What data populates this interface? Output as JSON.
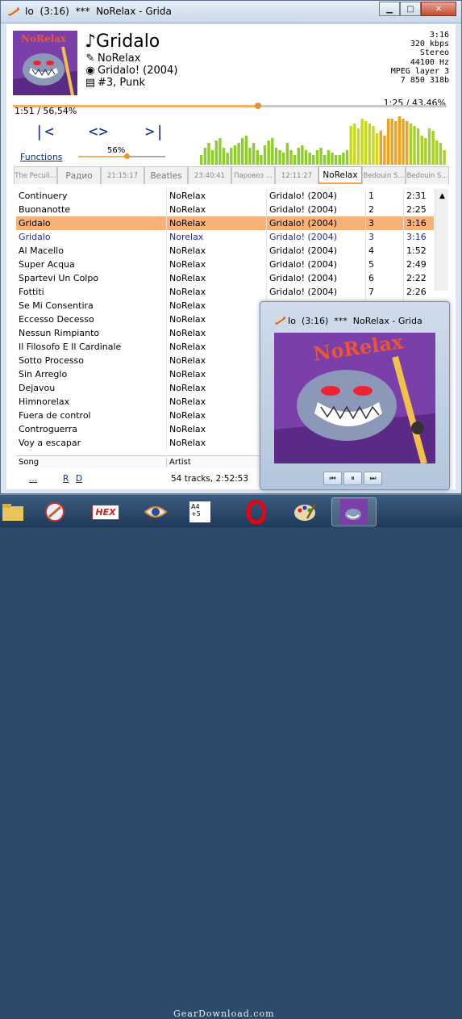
{
  "window": {
    "title": "Io  (3:16)  ***  NoRelax - Grida",
    "minimize": "▁",
    "maximize": "□",
    "close": "✕"
  },
  "now_playing": {
    "cover_brand": "NoRelax",
    "title": "Gridalo",
    "artist": "NoRelax",
    "album": "Gridalo! (2004)",
    "track": "#3, Punk",
    "tech": [
      "3:16",
      "320 kbps",
      "Stereo",
      "44100 Hz",
      "MPEG layer 3",
      "7 850 318b"
    ],
    "elapsed": "1:51 / 56,54%",
    "remaining": "1:25 / 43,46%",
    "progress_fraction": 0.5654
  },
  "controls": {
    "prev": "|<",
    "play": "<>",
    "next": ">|",
    "functions_link": "Functions",
    "volume_label": "56%",
    "volume_fraction": 0.56
  },
  "spectrum_levels": [
    0.2,
    0.35,
    0.45,
    0.3,
    0.5,
    0.55,
    0.35,
    0.25,
    0.35,
    0.4,
    0.45,
    0.55,
    0.6,
    0.35,
    0.45,
    0.3,
    0.2,
    0.4,
    0.5,
    0.55,
    0.35,
    0.3,
    0.25,
    0.45,
    0.3,
    0.2,
    0.35,
    0.4,
    0.3,
    0.25,
    0.2,
    0.3,
    0.35,
    0.2,
    0.3,
    0.25,
    0.2,
    0.2,
    0.25,
    0.3,
    0.8,
    0.85,
    0.75,
    0.95,
    0.9,
    0.85,
    0.8,
    0.65,
    0.7,
    0.6,
    0.95,
    0.95,
    0.9,
    1.0,
    0.95,
    0.9,
    0.85,
    0.8,
    0.75,
    0.6,
    0.55,
    0.75,
    0.7,
    0.5,
    0.45,
    0.3
  ],
  "tabs": [
    {
      "label": "The Peculi...",
      "big": false
    },
    {
      "label": "Радио",
      "big": true
    },
    {
      "label": "21:15:17",
      "big": false
    },
    {
      "label": "Beatles",
      "big": true
    },
    {
      "label": "23:40:41",
      "big": false
    },
    {
      "label": "Паровоз ...",
      "big": false
    },
    {
      "label": "12:11:27",
      "big": false
    },
    {
      "label": "NoRelax",
      "big": true,
      "active": true
    },
    {
      "label": "Bedouin S...",
      "big": false
    },
    {
      "label": "Bedouin S...",
      "big": false
    }
  ],
  "playlist": [
    {
      "title": "Continuery",
      "artist": "NoRelax",
      "album": "Gridalo! (2004)",
      "num": "1",
      "time": "2:31"
    },
    {
      "title": "Buonanotte",
      "artist": "NoRelax",
      "album": "Gridalo! (2004)",
      "num": "2",
      "time": "2:25"
    },
    {
      "title": "Gridalo",
      "artist": "NoRelax",
      "album": "Gridalo! (2004)",
      "num": "3",
      "time": "3:16",
      "state": "sel"
    },
    {
      "title": "Gridalo",
      "artist": "Norelax",
      "album": "Gridalo! (2004)",
      "num": "3",
      "time": "3:16",
      "state": "blue"
    },
    {
      "title": "Al Macello",
      "artist": "NoRelax",
      "album": "Gridalo! (2004)",
      "num": "4",
      "time": "1:52"
    },
    {
      "title": "Super Acqua",
      "artist": "NoRelax",
      "album": "Gridalo! (2004)",
      "num": "5",
      "time": "2:49"
    },
    {
      "title": "Spartevi Un Colpo",
      "artist": "NoRelax",
      "album": "Gridalo! (2004)",
      "num": "6",
      "time": "2:22"
    },
    {
      "title": "Fottiti",
      "artist": "NoRelax",
      "album": "Gridalo! (2004)",
      "num": "7",
      "time": "2:26"
    },
    {
      "title": "Se Mi Consentira",
      "artist": "NoRelax",
      "album": "",
      "num": "",
      "time": ""
    },
    {
      "title": "Eccesso Decesso",
      "artist": "NoRelax",
      "album": "",
      "num": "",
      "time": ""
    },
    {
      "title": "Nessun Rimpianto",
      "artist": "NoRelax",
      "album": "",
      "num": "",
      "time": ""
    },
    {
      "title": "Il Filosofo E Il Cardinale",
      "artist": "NoRelax",
      "album": "",
      "num": "",
      "time": ""
    },
    {
      "title": "Sotto Processo",
      "artist": "NoRelax",
      "album": "",
      "num": "",
      "time": ""
    },
    {
      "title": "Sin Arreglo",
      "artist": "NoRelax",
      "album": "",
      "num": "",
      "time": ""
    },
    {
      "title": "Dejavou",
      "artist": "NoRelax",
      "album": "",
      "num": "",
      "time": ""
    },
    {
      "title": "Himnorelax",
      "artist": "NoRelax",
      "album": "",
      "num": "",
      "time": ""
    },
    {
      "title": "Fuera de control",
      "artist": "NoRelax",
      "album": "",
      "num": "",
      "time": ""
    },
    {
      "title": "Controguerra",
      "artist": "NoRelax",
      "album": "",
      "num": "",
      "time": ""
    },
    {
      "title": "Voy a escapar",
      "artist": "NoRelax",
      "album": "",
      "num": "",
      "time": ""
    }
  ],
  "columns": {
    "song": "Song",
    "artist": "Artist"
  },
  "status": {
    "more": "...",
    "r": "R",
    "d": "D",
    "info": "54 tracks, 2:52:53"
  },
  "popup": {
    "title": "Io  (3:16)  ***  NoRelax - Grida",
    "cover_brand": "NoRelax",
    "prev": "⏮",
    "pause": "⏸",
    "next": "⏭"
  },
  "taskbar": {
    "hex_label": "HEX",
    "a4_label": "A4 +5",
    "watermark": "GearDownload.com"
  },
  "colors": {
    "accent": "#f4ad6a",
    "selected_row": "#f6b177",
    "link": "#0b2e8e",
    "cover": "#7a3fa8"
  }
}
